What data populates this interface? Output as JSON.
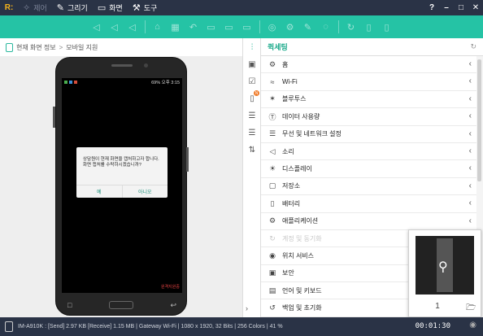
{
  "menubar": {
    "logo": "R:",
    "items": [
      {
        "icon": "✧",
        "label": "제어",
        "disabled": true
      },
      {
        "icon": "✎",
        "label": "그리기",
        "disabled": false
      },
      {
        "icon": "▭",
        "label": "화면",
        "disabled": false
      },
      {
        "icon": "⚒",
        "label": "도구",
        "disabled": false
      }
    ],
    "window_controls": [
      "?",
      "–",
      "□",
      "✕"
    ]
  },
  "toolbar": {
    "icons": [
      "◁",
      "◁",
      "◁",
      "|",
      "⌂",
      "▦",
      "↶",
      "▭",
      "▭",
      "▭",
      "|",
      "◎",
      "⚙",
      "✎",
      "◌",
      "|",
      "↻",
      "▯",
      "▯"
    ]
  },
  "breadcrumb": {
    "first": "현재 화면 정보",
    "separator": ">",
    "second": "모바일 지원"
  },
  "phone": {
    "status_left": "",
    "status_right": "69% 오후 3:15",
    "dialog_message": "상담원이 현재 화면을 캡처하고자 합니다. 화면 캡처를 수락하시겠습니까?",
    "dialog_yes": "예",
    "dialog_no": "아니오",
    "screen_label": "원격지원중"
  },
  "settings_sidebar": [
    "⫶",
    "▣",
    "☑",
    "▯",
    "☰",
    "☰",
    "⇅"
  ],
  "settings": {
    "title": "퀵세팅",
    "rows": [
      {
        "icon": "⚙",
        "label": "홈",
        "dim": false,
        "chevron": true
      },
      {
        "icon": "≈",
        "label": "Wi-Fi",
        "dim": false,
        "chevron": true
      },
      {
        "icon": "✶",
        "label": "블루투스",
        "dim": false,
        "chevron": true
      },
      {
        "icon": "Ⓣ",
        "label": "데이터 사용량",
        "dim": false,
        "chevron": true
      },
      {
        "icon": "☰",
        "label": "무선 및 네트워크 설정",
        "dim": false,
        "chevron": true
      },
      {
        "icon": "◁",
        "label": "소리",
        "dim": false,
        "chevron": true
      },
      {
        "icon": "☀",
        "label": "디스플레이",
        "dim": false,
        "chevron": true
      },
      {
        "icon": "▢",
        "label": "저장소",
        "dim": false,
        "chevron": true
      },
      {
        "icon": "▯",
        "label": "배터리",
        "dim": false,
        "chevron": true
      },
      {
        "icon": "⚙",
        "label": "애플리케이션",
        "dim": false,
        "chevron": true
      },
      {
        "icon": "↻",
        "label": "계정 및 동기화",
        "dim": true,
        "chevron": false
      },
      {
        "icon": "◉",
        "label": "위치 서비스",
        "dim": false,
        "chevron": false
      },
      {
        "icon": "▣",
        "label": "보안",
        "dim": false,
        "chevron": false
      },
      {
        "icon": "▤",
        "label": "언어 및 키보드",
        "dim": false,
        "chevron": false
      },
      {
        "icon": "↺",
        "label": "백업 및 초기화",
        "dim": false,
        "chevron": false
      }
    ]
  },
  "preview": {
    "page": "1"
  },
  "status": {
    "info": "IM-A910K : [Send] 2.97 KB  [Receive] 1.15 MB | Gateway Wi-Fi | 1080 x 1920, 32 Bits | 256 Colors | 41 %",
    "time": "00:01:30"
  }
}
